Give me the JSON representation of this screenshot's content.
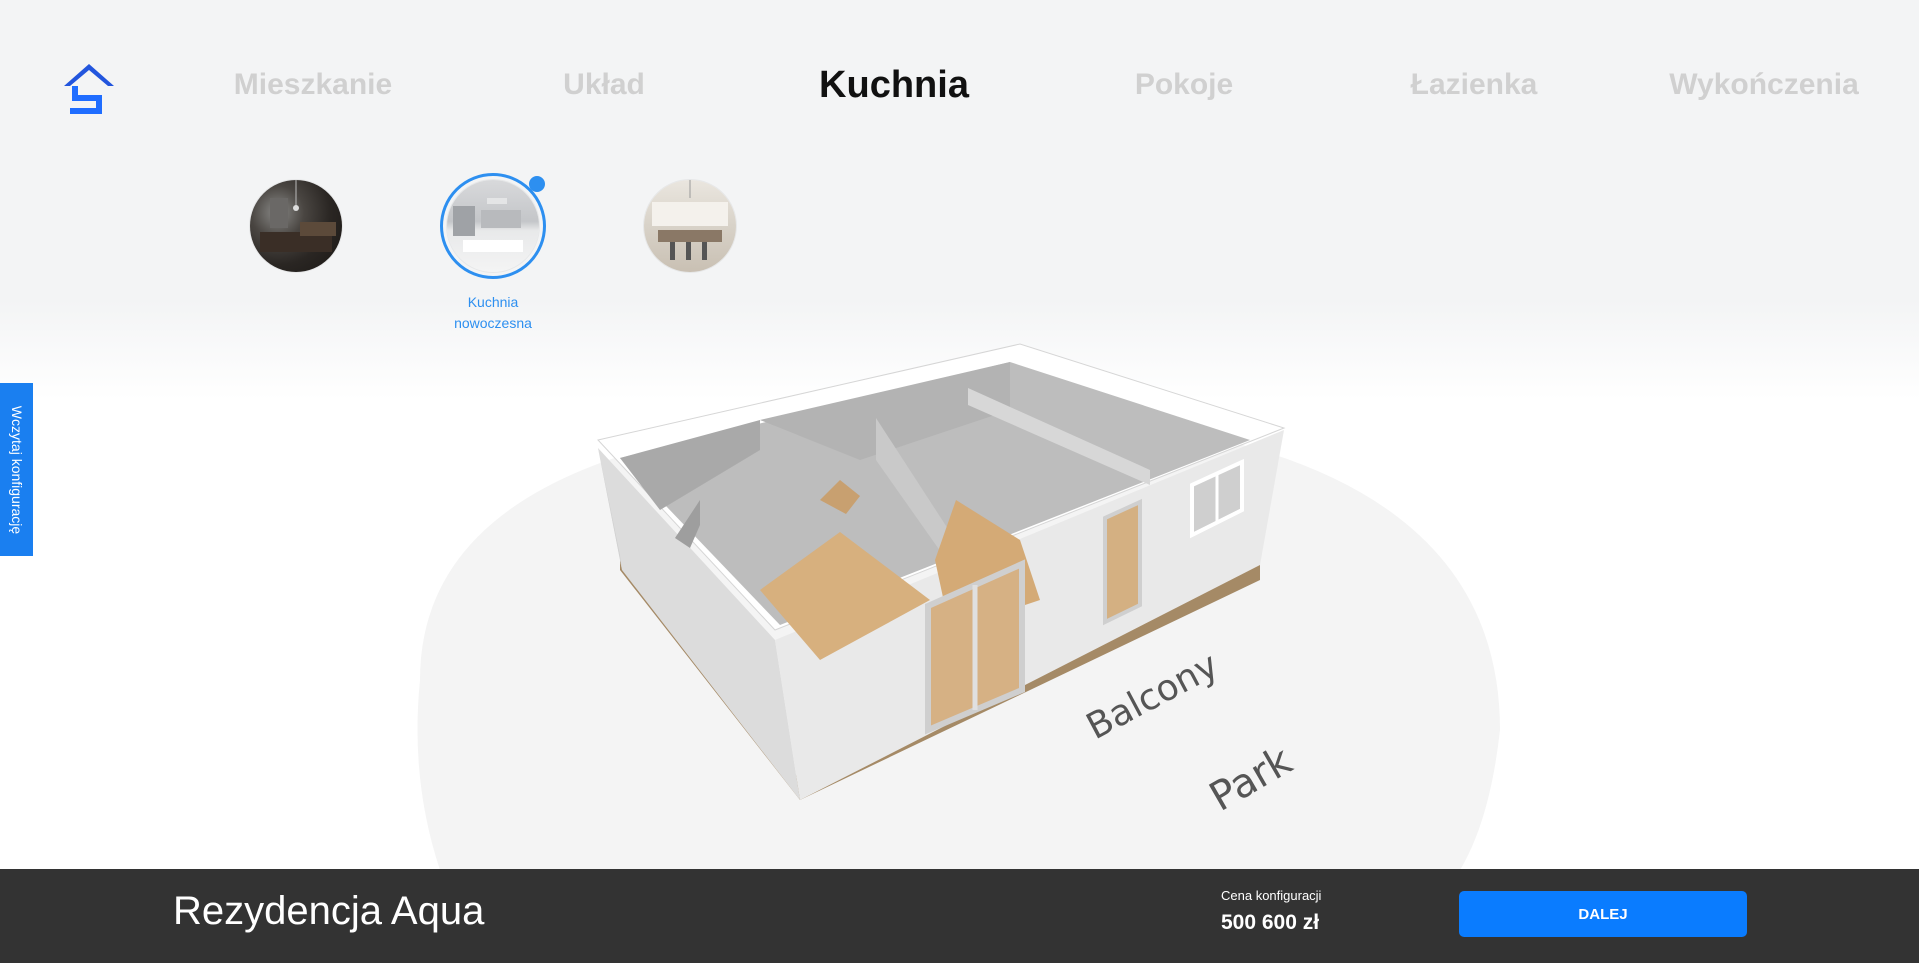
{
  "nav": {
    "steps": [
      {
        "label": "Mieszkanie",
        "active": false
      },
      {
        "label": "Układ",
        "active": false
      },
      {
        "label": "Kuchnia",
        "active": true
      },
      {
        "label": "Pokoje",
        "active": false
      },
      {
        "label": "Łazienka",
        "active": false
      },
      {
        "label": "Wykończenia",
        "active": false
      }
    ]
  },
  "logo": {
    "icon": "house-logo-icon",
    "color": "#2255dd"
  },
  "kitchen_options": [
    {
      "image": "dark-kitchen-photo",
      "label": "",
      "selected": false
    },
    {
      "image": "modern-white-kitchen-photo",
      "label": "Kuchnia nowoczesna",
      "selected": true
    },
    {
      "image": "classic-kitchen-photo",
      "label": "",
      "selected": false
    }
  ],
  "side_tab": {
    "label": "Wczytaj konfigurację"
  },
  "scene": {
    "labels": {
      "balcony": "Balcony",
      "park": "Park"
    }
  },
  "footer": {
    "project_name": "Rezydencja Aqua",
    "price_label": "Cena konfiguracji",
    "price_value": "500 600 zł",
    "next_button": "DALEJ"
  },
  "colors": {
    "accent": "#0a7cff",
    "selected": "#2d8ff0",
    "footer_bg": "#333333",
    "inactive_nav": "#d0d0d0"
  }
}
